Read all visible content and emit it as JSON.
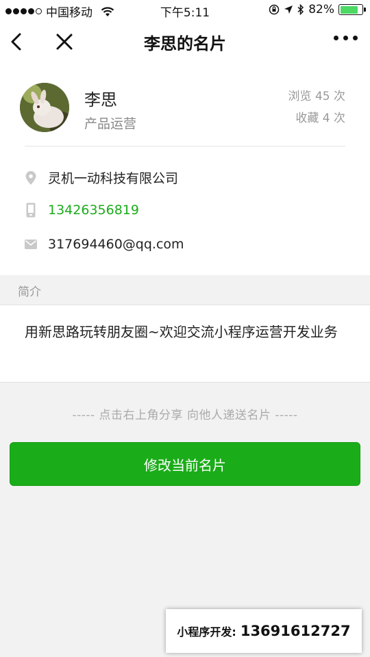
{
  "status_bar": {
    "carrier": "中国移动",
    "time": "下午5:11",
    "battery": "82%",
    "battery_level": 0.82
  },
  "nav": {
    "title": "李思的名片",
    "icons": [
      "back-icon",
      "close-icon",
      "more-icon"
    ]
  },
  "profile": {
    "name": "李思",
    "title": "产品运营",
    "views": "浏览 45 次",
    "favorites": "收藏 4 次"
  },
  "contact": {
    "company": "灵机一动科技有限公司",
    "phone": "13426356819",
    "email": "317694460@qq.com",
    "icons": [
      "location-icon",
      "phone-icon",
      "mail-icon"
    ]
  },
  "intro": {
    "header": "简介",
    "text": "用新思路玩转朋友圈~欢迎交流小程序运营开发业务"
  },
  "share_tip": "----- 点击右上角分享 向他人递送名片 -----",
  "edit_button": "修改当前名片",
  "promo": {
    "label": "小程序开发:",
    "number": "13691612727"
  },
  "colors": {
    "accent": "#1aad19",
    "background": "#f2f2f2"
  }
}
